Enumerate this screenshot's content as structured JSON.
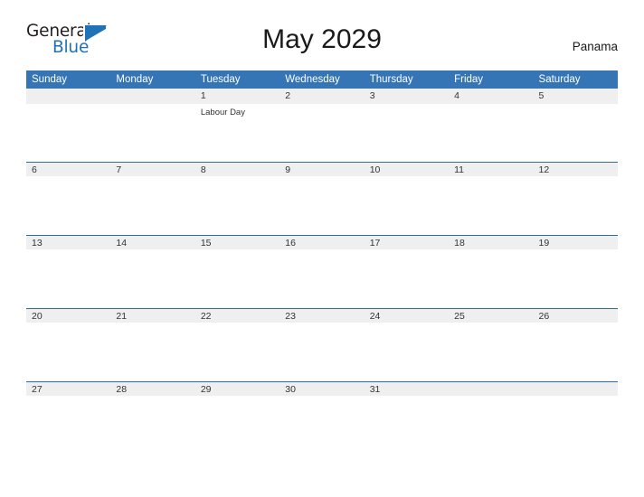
{
  "brand": {
    "word1": "General",
    "word2": "Blue",
    "flag_icon": "flag-triangle-icon",
    "accent_color": "#1f72b8"
  },
  "header": {
    "title": "May 2029",
    "locale": "Panama"
  },
  "colors": {
    "header_blue": "#3575b5",
    "row_rule_blue": "#2e6da4",
    "daynum_band_gray": "#efefef",
    "text": "#333333"
  },
  "calendar": {
    "month": "May",
    "year": "2029",
    "weekday_headers": [
      "Sunday",
      "Monday",
      "Tuesday",
      "Wednesday",
      "Thursday",
      "Friday",
      "Saturday"
    ],
    "weeks": [
      [
        {
          "day": "",
          "event": ""
        },
        {
          "day": "",
          "event": ""
        },
        {
          "day": "1",
          "event": "Labour Day"
        },
        {
          "day": "2",
          "event": ""
        },
        {
          "day": "3",
          "event": ""
        },
        {
          "day": "4",
          "event": ""
        },
        {
          "day": "5",
          "event": ""
        }
      ],
      [
        {
          "day": "6",
          "event": ""
        },
        {
          "day": "7",
          "event": ""
        },
        {
          "day": "8",
          "event": ""
        },
        {
          "day": "9",
          "event": ""
        },
        {
          "day": "10",
          "event": ""
        },
        {
          "day": "11",
          "event": ""
        },
        {
          "day": "12",
          "event": ""
        }
      ],
      [
        {
          "day": "13",
          "event": ""
        },
        {
          "day": "14",
          "event": ""
        },
        {
          "day": "15",
          "event": ""
        },
        {
          "day": "16",
          "event": ""
        },
        {
          "day": "17",
          "event": ""
        },
        {
          "day": "18",
          "event": ""
        },
        {
          "day": "19",
          "event": ""
        }
      ],
      [
        {
          "day": "20",
          "event": ""
        },
        {
          "day": "21",
          "event": ""
        },
        {
          "day": "22",
          "event": ""
        },
        {
          "day": "23",
          "event": ""
        },
        {
          "day": "24",
          "event": ""
        },
        {
          "day": "25",
          "event": ""
        },
        {
          "day": "26",
          "event": ""
        }
      ],
      [
        {
          "day": "27",
          "event": ""
        },
        {
          "day": "28",
          "event": ""
        },
        {
          "day": "29",
          "event": ""
        },
        {
          "day": "30",
          "event": ""
        },
        {
          "day": "31",
          "event": ""
        },
        {
          "day": "",
          "event": ""
        },
        {
          "day": "",
          "event": ""
        }
      ]
    ]
  }
}
